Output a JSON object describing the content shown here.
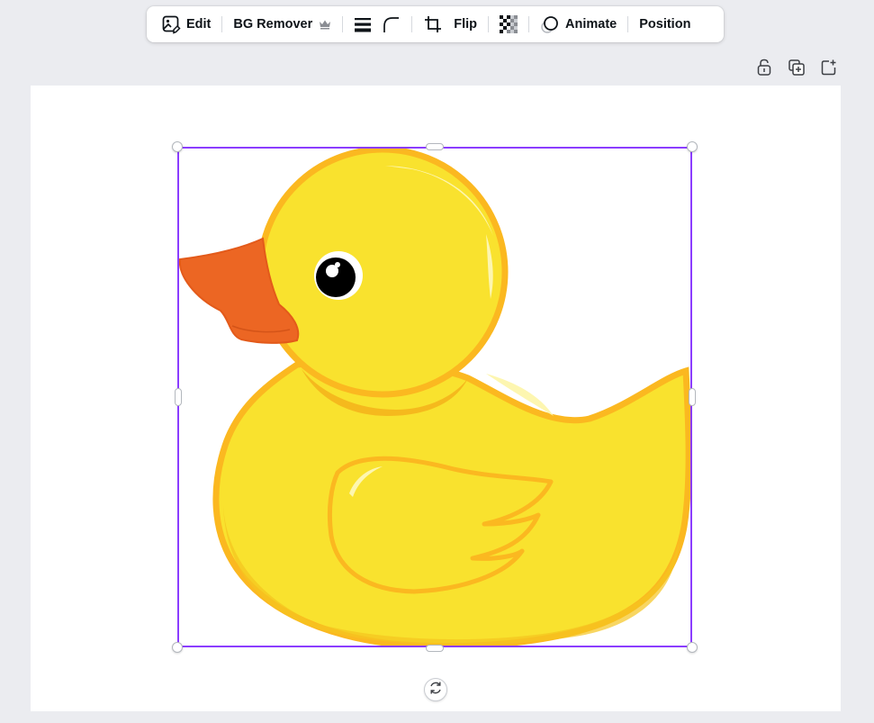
{
  "toolbar": {
    "edit_label": "Edit",
    "bg_remover_label": "BG Remover",
    "flip_label": "Flip",
    "animate_label": "Animate",
    "position_label": "Position",
    "icons": [
      "image-edit-icon",
      "crown-icon",
      "border-style-icon",
      "corner-rounding-icon",
      "crop-icon",
      "transparency-icon",
      "animate-icon"
    ]
  },
  "page_actions": {
    "icons": [
      "unlock-icon",
      "duplicate-page-icon",
      "add-page-icon"
    ]
  },
  "canvas": {
    "element": "rubber-duck-graphic",
    "selection_color": "#8b3dff",
    "duck_colors": {
      "body": "#f9e22e",
      "outline": "#fbb820",
      "beak": "#ec6623",
      "eye": "#000000"
    }
  }
}
